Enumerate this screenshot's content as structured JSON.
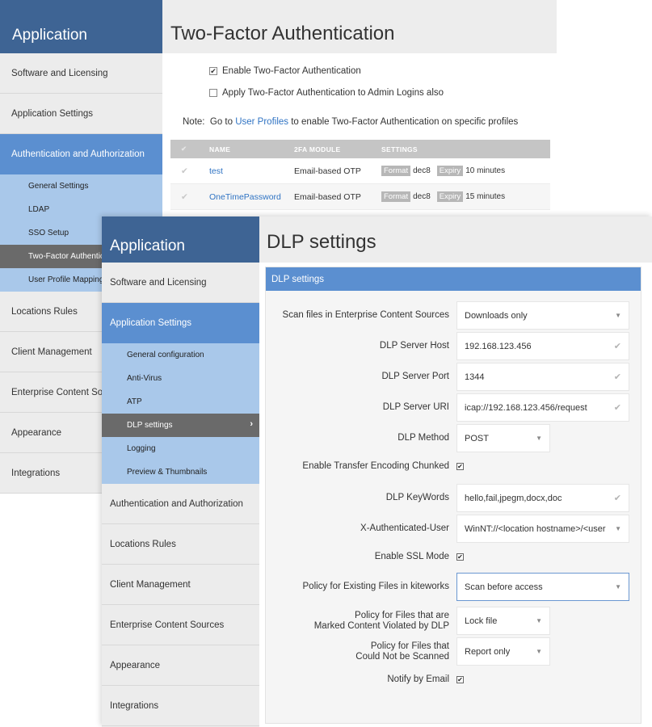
{
  "back": {
    "sidebar": {
      "header": "Application",
      "items_top": [
        {
          "label": "Software and Licensing"
        },
        {
          "label": "Application Settings"
        },
        {
          "label": "Authentication and Authorization"
        }
      ],
      "subitems": [
        {
          "label": "General Settings"
        },
        {
          "label": "LDAP"
        },
        {
          "label": "SSO Setup"
        },
        {
          "label": "Two-Factor Authentication"
        },
        {
          "label": "User Profile Mapping"
        }
      ],
      "items_bottom": [
        {
          "label": "Locations Rules"
        },
        {
          "label": "Client Management"
        },
        {
          "label": "Enterprise Content Sources"
        },
        {
          "label": "Appearance"
        },
        {
          "label": "Integrations"
        }
      ]
    },
    "title": "Two-Factor Authentication",
    "enable_2fa": {
      "label": "Enable Two-Factor Authentication",
      "check": "✔"
    },
    "apply_admin": {
      "label": "Apply Two-Factor Authentication to Admin Logins also",
      "check": ""
    },
    "note": {
      "prefix": "Note:  Go to ",
      "link": "User Profiles",
      "suffix": " to enable Two-Factor Authentication on specific profiles"
    },
    "table": {
      "check_header": "✔",
      "headers": [
        "NAME",
        "2FA MODULE",
        "SETTINGS"
      ],
      "rows": [
        {
          "check": "✔",
          "name": "test",
          "module": "Email-based OTP",
          "format_tag": "Format",
          "format_val": "dec8",
          "expiry_tag": "Expiry",
          "expiry_val": "10 minutes"
        },
        {
          "check": "✔",
          "name": "OneTimePassword",
          "module": "Email-based OTP",
          "format_tag": "Format",
          "format_val": "dec8",
          "expiry_tag": "Expiry",
          "expiry_val": "15 minutes"
        }
      ]
    }
  },
  "front": {
    "sidebar": {
      "header": "Application",
      "items_top": [
        {
          "label": "Software and Licensing"
        },
        {
          "label": "Application Settings"
        }
      ],
      "subitems": [
        {
          "label": "General configuration"
        },
        {
          "label": "Anti-Virus"
        },
        {
          "label": "ATP"
        },
        {
          "label": "DLP settings"
        },
        {
          "label": "Logging"
        },
        {
          "label": "Preview & Thumbnails"
        }
      ],
      "chevron": "›",
      "items_bottom": [
        {
          "label": "Authentication and Authorization"
        },
        {
          "label": "Locations Rules"
        },
        {
          "label": "Client Management"
        },
        {
          "label": "Enterprise Content Sources"
        },
        {
          "label": "Appearance"
        },
        {
          "label": "Integrations"
        }
      ]
    },
    "title": "DLP settings",
    "panel_title": "DLP settings",
    "fields": {
      "scan_files": {
        "label": "Scan files in Enterprise Content Sources",
        "value": "Downloads only",
        "icon": "caret-down-icon"
      },
      "server_host": {
        "label": "DLP Server Host",
        "value": "192.168.123.456",
        "icon": "check-icon"
      },
      "server_port": {
        "label": "DLP Server Port",
        "value": "1344",
        "icon": "check-icon"
      },
      "server_uri": {
        "label": "DLP Server URI",
        "value": "icap://192.168.123.456/request",
        "icon": "check-icon"
      },
      "method": {
        "label": "DLP Method",
        "value": "POST",
        "icon": "caret-down-icon"
      },
      "chunked": {
        "label": "Enable Transfer Encoding Chunked",
        "check": "✔"
      },
      "keywords": {
        "label": "DLP KeyWords",
        "value": "hello,fail,jpegm,docx,doc",
        "icon": "check-icon"
      },
      "auth_user": {
        "label": "X-Authenticated-User",
        "value": "WinNT://<location hostname>/<user",
        "icon": "caret-down-icon"
      },
      "ssl": {
        "label": "Enable SSL Mode",
        "check": "✔"
      },
      "existing_policy": {
        "label": "Policy for Existing Files in kiteworks",
        "value": "Scan before access",
        "icon": "caret-down-icon"
      },
      "violated_policy": {
        "label_1": "Policy for Files that are",
        "label_2": "Marked Content Violated by DLP",
        "value": "Lock file",
        "icon": "caret-down-icon"
      },
      "unscanned_policy": {
        "label_1": "Policy for Files that",
        "label_2": "Could Not be Scanned",
        "value": "Report only",
        "icon": "caret-down-icon"
      },
      "notify_email": {
        "label": "Notify by Email",
        "check": "✔"
      }
    },
    "glyphs": {
      "caret": "▼",
      "tick": "✔"
    }
  }
}
